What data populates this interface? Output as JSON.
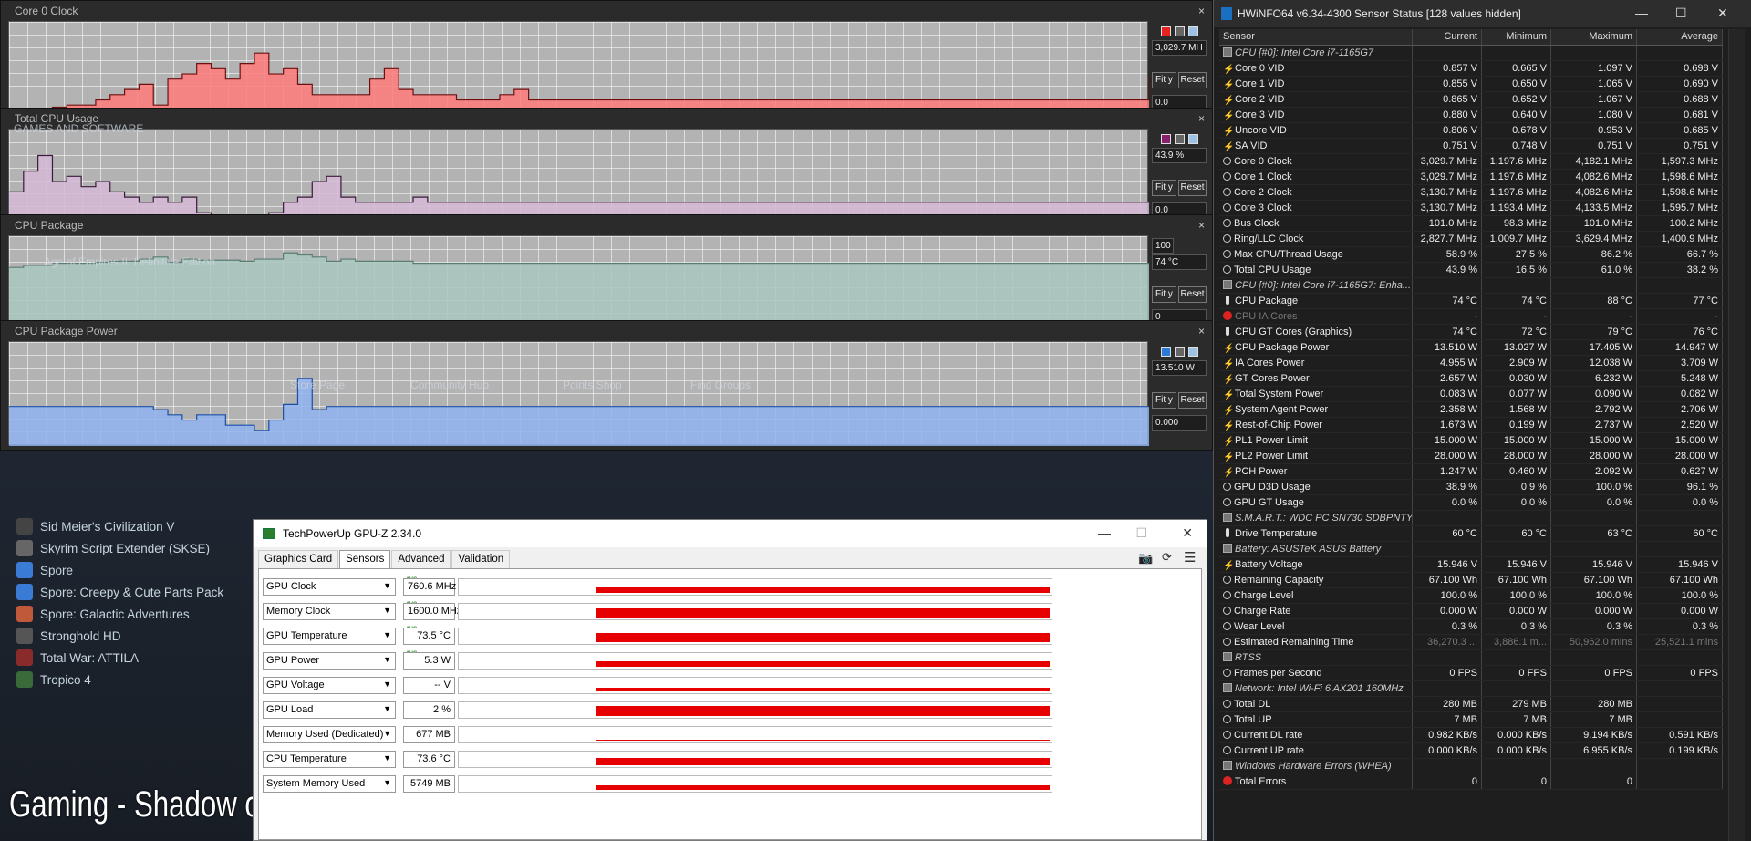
{
  "graphs": [
    {
      "title": "Core 0 Clock",
      "color": "#ff7b7b",
      "line": "#6e1010",
      "swatch": "#e62222",
      "top_value": "3,029.7 MH",
      "bottom_value": "0.0",
      "series": [
        0.1,
        0.12,
        0.14,
        0.18,
        0.2,
        0.2,
        0.25,
        0.3,
        0.35,
        0.4,
        0.2,
        0.45,
        0.5,
        0.6,
        0.55,
        0.45,
        0.6,
        0.7,
        0.5,
        0.55,
        0.4,
        0.3,
        0.3,
        0.3,
        0.3,
        0.45,
        0.55,
        0.35,
        0.3,
        0.3,
        0.3,
        0.25,
        0.25,
        0.25,
        0.3,
        0.35,
        0.25,
        0.25,
        0.25,
        0.25,
        0.25,
        0.25,
        0.25,
        0.25,
        0.25,
        0.25,
        0.25,
        0.25,
        0.25,
        0.25,
        0.25,
        0.25,
        0.25,
        0.25,
        0.25,
        0.25,
        0.25,
        0.25,
        0.25,
        0.25,
        0.25,
        0.25,
        0.25,
        0.25,
        0.25,
        0.25,
        0.25,
        0.25,
        0.25,
        0.25,
        0.25,
        0.25,
        0.25,
        0.25,
        0.25,
        0.25,
        0.25,
        0.25,
        0.25,
        0.5
      ]
    },
    {
      "title": "Total CPU Usage",
      "color": "#d6b8d6",
      "line": "#3b1a3b",
      "swatch": "#8a1f6e",
      "top_value": "43.9 %",
      "bottom_value": "0.0",
      "series": [
        0.4,
        0.6,
        0.75,
        0.5,
        0.55,
        0.45,
        0.5,
        0.4,
        0.35,
        0.3,
        0.35,
        0.3,
        0.35,
        0.2,
        0.15,
        0.1,
        0.1,
        0.15,
        0.2,
        0.3,
        0.35,
        0.5,
        0.55,
        0.35,
        0.3,
        0.3,
        0.3,
        0.3,
        0.35,
        0.3,
        0.3,
        0.3,
        0.3,
        0.3,
        0.3,
        0.3,
        0.3,
        0.3,
        0.3,
        0.3,
        0.3,
        0.3,
        0.3,
        0.3,
        0.3,
        0.3,
        0.3,
        0.3,
        0.3,
        0.3,
        0.3,
        0.3,
        0.3,
        0.3,
        0.3,
        0.3,
        0.3,
        0.3,
        0.3,
        0.3,
        0.3,
        0.3,
        0.3,
        0.3,
        0.3,
        0.3,
        0.3,
        0.3,
        0.3,
        0.3,
        0.3,
        0.3,
        0.3,
        0.3,
        0.3,
        0.3,
        0.3,
        0.3,
        0.3,
        0.35
      ]
    },
    {
      "title": "CPU Package",
      "color": "#a9c7c0",
      "line": "#5a7d73",
      "swatch": "",
      "top_value": "74 °C",
      "bottom_value": "0",
      "range_top": "100",
      "series": [
        0.7,
        0.72,
        0.72,
        0.74,
        0.74,
        0.74,
        0.75,
        0.76,
        0.76,
        0.78,
        0.8,
        0.75,
        0.78,
        0.77,
        0.77,
        0.77,
        0.76,
        0.78,
        0.78,
        0.84,
        0.82,
        0.8,
        0.76,
        0.78,
        0.76,
        0.76,
        0.76,
        0.76,
        0.74,
        0.74,
        0.74,
        0.74,
        0.74,
        0.74,
        0.74,
        0.74,
        0.74,
        0.74,
        0.74,
        0.74,
        0.74,
        0.74,
        0.74,
        0.74,
        0.74,
        0.74,
        0.74,
        0.74,
        0.74,
        0.74,
        0.74,
        0.74,
        0.74,
        0.74,
        0.74,
        0.74,
        0.74,
        0.74,
        0.74,
        0.74,
        0.74,
        0.74,
        0.74,
        0.74,
        0.74,
        0.74,
        0.74,
        0.74,
        0.74,
        0.74,
        0.74,
        0.74,
        0.74,
        0.74,
        0.74,
        0.74,
        0.74,
        0.74,
        0.74,
        0.74
      ]
    },
    {
      "title": "CPU Package Power",
      "color": "#8fb3ef",
      "line": "#1a4fa8",
      "swatch": "#2a7ad6",
      "top_value": "13.510 W",
      "bottom_value": "0.000",
      "series": [
        0.38,
        0.38,
        0.38,
        0.38,
        0.38,
        0.38,
        0.38,
        0.38,
        0.38,
        0.38,
        0.35,
        0.3,
        0.25,
        0.3,
        0.3,
        0.2,
        0.2,
        0.15,
        0.25,
        0.4,
        0.65,
        0.35,
        0.38,
        0.38,
        0.38,
        0.38,
        0.38,
        0.38,
        0.38,
        0.38,
        0.38,
        0.38,
        0.38,
        0.38,
        0.38,
        0.38,
        0.38,
        0.38,
        0.38,
        0.38,
        0.38,
        0.38,
        0.38,
        0.38,
        0.38,
        0.38,
        0.38,
        0.38,
        0.38,
        0.38,
        0.38,
        0.38,
        0.38,
        0.38,
        0.38,
        0.38,
        0.38,
        0.38,
        0.38,
        0.38,
        0.38,
        0.38,
        0.38,
        0.38,
        0.38,
        0.38,
        0.38,
        0.38,
        0.38,
        0.38,
        0.38,
        0.38,
        0.38,
        0.38,
        0.38,
        0.38,
        0.38,
        0.38,
        0.38,
        0.38
      ]
    }
  ],
  "buttons": {
    "fit": "Fit y",
    "reset": "Reset"
  },
  "behind_text": [
    "GAMES AND SOFTWARE",
    "Age of Empires II: Definitive Edition",
    "Store Page",
    "Community Hub",
    "Points Shop",
    "Find Groups"
  ],
  "steam_list": [
    {
      "name": "Sid Meier's Civilization V",
      "icon": "#444"
    },
    {
      "name": "Skyrim Script Extender (SKSE)",
      "icon": "#666"
    },
    {
      "name": "Spore",
      "icon": "#3a7bd5"
    },
    {
      "name": "Spore: Creepy & Cute Parts Pack",
      "icon": "#3a7bd5"
    },
    {
      "name": "Spore: Galactic Adventures",
      "icon": "#c0583a"
    },
    {
      "name": "Stronghold HD",
      "icon": "#555"
    },
    {
      "name": "Total War: ATTILA",
      "icon": "#8a2b2b"
    },
    {
      "name": "Tropico 4",
      "icon": "#3a6a3a"
    }
  ],
  "caption": "Gaming -  Shadow of Mordor",
  "gpuz": {
    "title": "TechPowerUp GPU-Z 2.34.0",
    "tabs": [
      "Graphics Card",
      "Sensors",
      "Advanced",
      "Validation"
    ],
    "avg_tag": "AVG",
    "rows": [
      {
        "label": "GPU Clock",
        "value": "760.6 MHz",
        "avg": true,
        "level": 0.55
      },
      {
        "label": "Memory Clock",
        "value": "1600.0 MHz",
        "avg": true,
        "level": 0.7
      },
      {
        "label": "GPU Temperature",
        "value": "73.5 °C",
        "avg": true,
        "level": 0.7
      },
      {
        "label": "GPU Power",
        "value": "5.3 W",
        "avg": true,
        "level": 0.45
      },
      {
        "label": "GPU Voltage",
        "value": "-- V",
        "avg": false,
        "level": 0.35
      },
      {
        "label": "GPU Load",
        "value": "2 %",
        "avg": false,
        "level": 0.75
      },
      {
        "label": "Memory Used (Dedicated)",
        "value": "677 MB",
        "avg": false,
        "level": 0.15
      },
      {
        "label": "CPU Temperature",
        "value": "73.6 °C",
        "avg": false,
        "level": 0.6
      },
      {
        "label": "System Memory Used",
        "value": "5749 MB",
        "avg": false,
        "level": 0.4
      }
    ]
  },
  "hwinfo": {
    "title": "HWiNFO64 v6.34-4300 Sensor Status [128 values hidden]",
    "headers": [
      "Sensor",
      "Current",
      "Minimum",
      "Maximum",
      "Average"
    ],
    "rows": [
      {
        "t": "g",
        "icon": "chip",
        "name": "CPU [#0]: Intel Core i7-1165G7"
      },
      {
        "icon": "bolt",
        "name": "Core 0 VID",
        "cur": "0.857 V",
        "min": "0.665 V",
        "max": "1.097 V",
        "avg": "0.698 V"
      },
      {
        "icon": "bolt",
        "name": "Core 1 VID",
        "cur": "0.855 V",
        "min": "0.650 V",
        "max": "1.065 V",
        "avg": "0.690 V"
      },
      {
        "icon": "bolt",
        "name": "Core 2 VID",
        "cur": "0.865 V",
        "min": "0.652 V",
        "max": "1.067 V",
        "avg": "0.688 V"
      },
      {
        "icon": "bolt",
        "name": "Core 3 VID",
        "cur": "0.880 V",
        "min": "0.640 V",
        "max": "1.080 V",
        "avg": "0.681 V"
      },
      {
        "icon": "bolt",
        "name": "Uncore VID",
        "cur": "0.806 V",
        "min": "0.678 V",
        "max": "0.953 V",
        "avg": "0.685 V"
      },
      {
        "icon": "bolt",
        "name": "SA VID",
        "cur": "0.751 V",
        "min": "0.748 V",
        "max": "0.751 V",
        "avg": "0.751 V"
      },
      {
        "icon": "clk",
        "name": "Core 0 Clock",
        "cur": "3,029.7 MHz",
        "min": "1,197.6 MHz",
        "max": "4,182.1 MHz",
        "avg": "1,597.3 MHz"
      },
      {
        "icon": "clk",
        "name": "Core 1 Clock",
        "cur": "3,029.7 MHz",
        "min": "1,197.6 MHz",
        "max": "4,082.6 MHz",
        "avg": "1,598.6 MHz"
      },
      {
        "icon": "clk",
        "name": "Core 2 Clock",
        "cur": "3,130.7 MHz",
        "min": "1,197.6 MHz",
        "max": "4,082.6 MHz",
        "avg": "1,598.6 MHz"
      },
      {
        "icon": "clk",
        "name": "Core 3 Clock",
        "cur": "3,130.7 MHz",
        "min": "1,193.4 MHz",
        "max": "4,133.5 MHz",
        "avg": "1,595.7 MHz"
      },
      {
        "icon": "clk",
        "name": "Bus Clock",
        "cur": "101.0 MHz",
        "min": "98.3 MHz",
        "max": "101.0 MHz",
        "avg": "100.2 MHz"
      },
      {
        "icon": "clk",
        "name": "Ring/LLC Clock",
        "cur": "2,827.7 MHz",
        "min": "1,009.7 MHz",
        "max": "3,629.4 MHz",
        "avg": "1,400.9 MHz"
      },
      {
        "icon": "clk",
        "name": "Max CPU/Thread Usage",
        "cur": "58.9 %",
        "min": "27.5 %",
        "max": "86.2 %",
        "avg": "66.7 %"
      },
      {
        "icon": "clk",
        "name": "Total CPU Usage",
        "cur": "43.9 %",
        "min": "16.5 %",
        "max": "61.0 %",
        "avg": "38.2 %"
      },
      {
        "t": "g",
        "icon": "chip",
        "name": "CPU [#0]: Intel Core i7-1165G7: Enha..."
      },
      {
        "icon": "therm",
        "name": "CPU Package",
        "cur": "74 °C",
        "min": "74 °C",
        "max": "88 °C",
        "avg": "77 °C"
      },
      {
        "t": "dim",
        "icon": "err",
        "name": "CPU IA Cores",
        "cur": "-",
        "min": "-",
        "max": "-",
        "avg": "-"
      },
      {
        "icon": "therm",
        "name": "CPU GT Cores (Graphics)",
        "cur": "74 °C",
        "min": "72 °C",
        "max": "79 °C",
        "avg": "76 °C"
      },
      {
        "icon": "bolt",
        "name": "CPU Package Power",
        "cur": "13.510 W",
        "min": "13.027 W",
        "max": "17.405 W",
        "avg": "14.947 W"
      },
      {
        "icon": "bolt",
        "name": "IA Cores Power",
        "cur": "4.955 W",
        "min": "2.909 W",
        "max": "12.038 W",
        "avg": "3.709 W"
      },
      {
        "icon": "bolt",
        "name": "GT Cores Power",
        "cur": "2.657 W",
        "min": "0.030 W",
        "max": "6.232 W",
        "avg": "5.248 W"
      },
      {
        "icon": "bolt",
        "name": "Total System Power",
        "cur": "0.083 W",
        "min": "0.077 W",
        "max": "0.090 W",
        "avg": "0.082 W"
      },
      {
        "icon": "bolt",
        "name": "System Agent Power",
        "cur": "2.358 W",
        "min": "1.568 W",
        "max": "2.792 W",
        "avg": "2.706 W"
      },
      {
        "icon": "bolt",
        "name": "Rest-of-Chip Power",
        "cur": "1.673 W",
        "min": "0.199 W",
        "max": "2.737 W",
        "avg": "2.520 W"
      },
      {
        "icon": "bolt",
        "name": "PL1 Power Limit",
        "cur": "15.000 W",
        "min": "15.000 W",
        "max": "15.000 W",
        "avg": "15.000 W"
      },
      {
        "icon": "bolt",
        "name": "PL2 Power Limit",
        "cur": "28.000 W",
        "min": "28.000 W",
        "max": "28.000 W",
        "avg": "28.000 W"
      },
      {
        "icon": "bolt",
        "name": "PCH Power",
        "cur": "1.247 W",
        "min": "0.460 W",
        "max": "2.092 W",
        "avg": "0.627 W"
      },
      {
        "icon": "clk",
        "name": "GPU D3D Usage",
        "cur": "38.9 %",
        "min": "0.9 %",
        "max": "100.0 %",
        "avg": "96.1 %"
      },
      {
        "icon": "clk",
        "name": "GPU GT Usage",
        "cur": "0.0 %",
        "min": "0.0 %",
        "max": "0.0 %",
        "avg": "0.0 %"
      },
      {
        "t": "g",
        "icon": "chip",
        "name": "S.M.A.R.T.: WDC PC SN730 SDBPNTY..."
      },
      {
        "icon": "therm",
        "name": "Drive Temperature",
        "cur": "60 °C",
        "min": "60 °C",
        "max": "63 °C",
        "avg": "60 °C"
      },
      {
        "t": "g",
        "icon": "chip",
        "name": "Battery: ASUSTeK ASUS Battery"
      },
      {
        "icon": "bolt",
        "name": "Battery Voltage",
        "cur": "15.946 V",
        "min": "15.946 V",
        "max": "15.946 V",
        "avg": "15.946 V"
      },
      {
        "icon": "clk",
        "name": "Remaining Capacity",
        "cur": "67.100 Wh",
        "min": "67.100 Wh",
        "max": "67.100 Wh",
        "avg": "67.100 Wh"
      },
      {
        "icon": "clk",
        "name": "Charge Level",
        "cur": "100.0 %",
        "min": "100.0 %",
        "max": "100.0 %",
        "avg": "100.0 %"
      },
      {
        "icon": "clk",
        "name": "Charge Rate",
        "cur": "0.000 W",
        "min": "0.000 W",
        "max": "0.000 W",
        "avg": "0.000 W"
      },
      {
        "icon": "clk",
        "name": "Wear Level",
        "cur": "0.3 %",
        "min": "0.3 %",
        "max": "0.3 %",
        "avg": "0.3 %"
      },
      {
        "t": "dimv",
        "icon": "clk",
        "name": "Estimated Remaining Time",
        "cur": "36,270.3 ...",
        "min": "3,886.1 m...",
        "max": "50,962.0 mins",
        "avg": "25,521.1 mins"
      },
      {
        "t": "g",
        "icon": "chip",
        "name": "RTSS"
      },
      {
        "icon": "clk",
        "name": "Frames per Second",
        "cur": "0 FPS",
        "min": "0 FPS",
        "max": "0 FPS",
        "avg": "0 FPS"
      },
      {
        "t": "g",
        "icon": "chip",
        "name": "Network: Intel Wi-Fi 6 AX201 160MHz"
      },
      {
        "icon": "clk",
        "name": "Total DL",
        "cur": "280 MB",
        "min": "279 MB",
        "max": "280 MB",
        "avg": ""
      },
      {
        "icon": "clk",
        "name": "Total UP",
        "cur": "7 MB",
        "min": "7 MB",
        "max": "7 MB",
        "avg": ""
      },
      {
        "icon": "clk",
        "name": "Current DL rate",
        "cur": "0.982 KB/s",
        "min": "0.000 KB/s",
        "max": "9.194 KB/s",
        "avg": "0.591 KB/s"
      },
      {
        "icon": "clk",
        "name": "Current UP rate",
        "cur": "0.000 KB/s",
        "min": "0.000 KB/s",
        "max": "6.955 KB/s",
        "avg": "0.199 KB/s"
      },
      {
        "t": "g",
        "icon": "chip",
        "name": "Windows Hardware Errors (WHEA)"
      },
      {
        "icon": "err",
        "name": "Total Errors",
        "cur": "0",
        "min": "0",
        "max": "0",
        "avg": ""
      }
    ]
  }
}
